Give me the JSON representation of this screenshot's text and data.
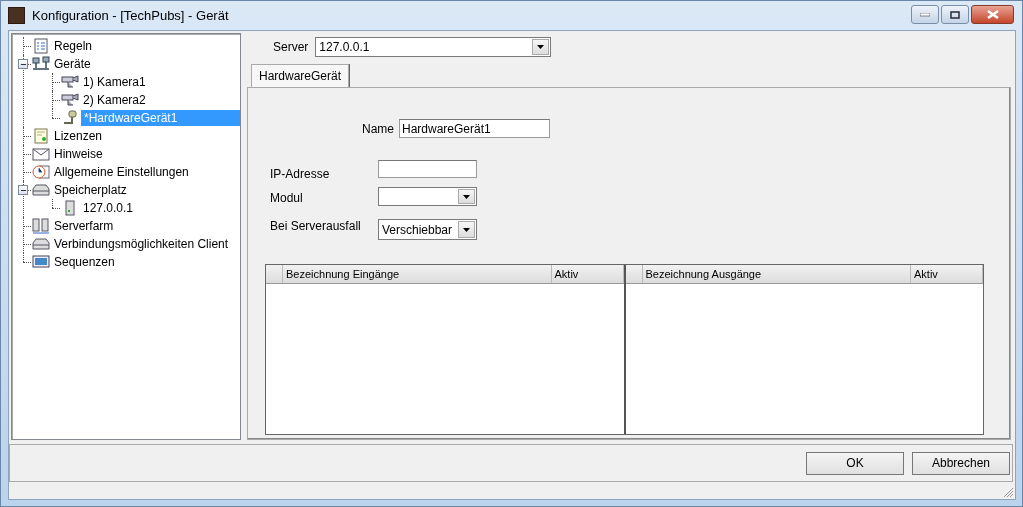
{
  "window": {
    "title": "Konfiguration - [TechPubs] - Gerät"
  },
  "tree": [
    {
      "label": "Regeln",
      "kind": "document",
      "selected": false
    },
    {
      "label": "Geräte",
      "kind": "network",
      "selected": false,
      "expanded": true,
      "children": [
        {
          "label": "1) Kamera1",
          "kind": "camera",
          "selected": false
        },
        {
          "label": "2) Kamera2",
          "kind": "camera",
          "selected": false
        },
        {
          "label": "*HardwareGerät1",
          "kind": "device",
          "selected": true
        }
      ]
    },
    {
      "label": "Lizenzen",
      "kind": "license",
      "selected": false
    },
    {
      "label": "Hinweise",
      "kind": "mail",
      "selected": false
    },
    {
      "label": "Allgemeine Einstellungen",
      "kind": "clock",
      "selected": false
    },
    {
      "label": "Speicherplatz",
      "kind": "drive",
      "selected": false,
      "expanded": true,
      "children": [
        {
          "label": "127.0.0.1",
          "kind": "server",
          "selected": false
        }
      ]
    },
    {
      "label": "Serverfarm",
      "kind": "servers",
      "selected": false
    },
    {
      "label": "Verbindungsmöglichkeiten Client",
      "kind": "drive",
      "selected": false
    },
    {
      "label": "Sequenzen",
      "kind": "monitor",
      "selected": false
    }
  ],
  "server": {
    "label": "Server",
    "value": "127.0.0.1"
  },
  "tabs": [
    {
      "label": "HardwareGerät",
      "selected": true
    }
  ],
  "form": {
    "name": {
      "label": "Name",
      "value": "HardwareGerät1"
    },
    "ip": {
      "label": "IP-Adresse"
    },
    "modul": {
      "label": "Modul"
    },
    "failover": {
      "label": "Bei Serverausfall",
      "value": "Verschiebbar"
    }
  },
  "tables": [
    {
      "columns": [
        "Bezeichnung Eingänge",
        "Aktiv"
      ]
    },
    {
      "columns": [
        "Bezeichnung Ausgänge",
        "Aktiv"
      ]
    }
  ],
  "buttons": [
    "OK",
    "Abbrechen"
  ]
}
